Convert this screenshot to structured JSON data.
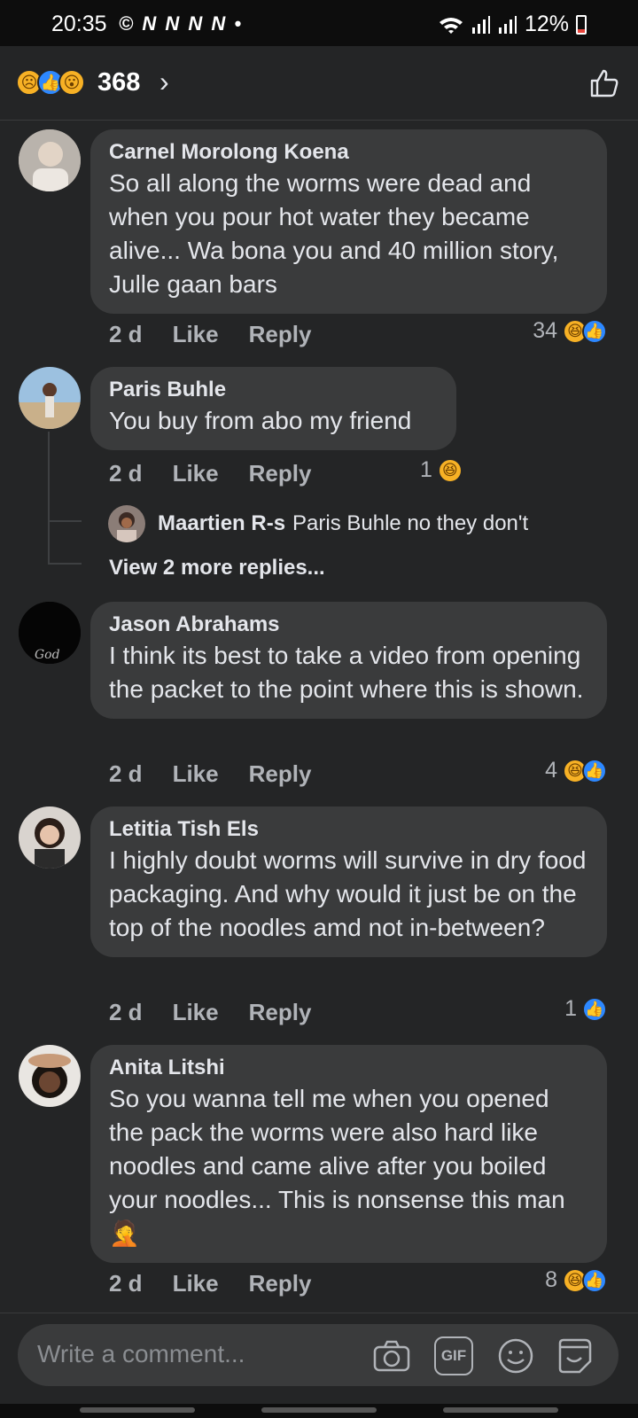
{
  "status": {
    "time": "20:35",
    "notifs": "© N N N N •",
    "battery": "12%"
  },
  "header": {
    "reaction_count": "368",
    "reaction_icons": [
      "sad-emoji-icon",
      "like-icon",
      "wow-emoji-icon"
    ]
  },
  "comments": [
    {
      "name": "Carnel Morolong Koena",
      "text": "So all along the worms were dead and when you pour hot water they became alive... Wa bona you and 40 million story, Julle gaan bars",
      "time": "2 d",
      "like": "Like",
      "reply": "Reply",
      "reaction_count": "34",
      "reactions": [
        "haha",
        "like"
      ]
    },
    {
      "name": "Paris Buhle",
      "text": "You buy from abo my friend",
      "time": "2 d",
      "like": "Like",
      "reply": "Reply",
      "reaction_count": "1",
      "reactions": [
        "haha"
      ],
      "reply_preview": {
        "name": "Maartien R-s",
        "text": "Paris Buhle no they don't"
      },
      "more_replies": "View 2 more replies..."
    },
    {
      "name": "Jason Abrahams",
      "text": "I think its best to take a video from opening the packet to the point where this is shown.",
      "time": "2 d",
      "like": "Like",
      "reply": "Reply",
      "reaction_count": "4",
      "reactions": [
        "haha",
        "like"
      ]
    },
    {
      "name": "Letitia Tish Els",
      "text": "I highly doubt worms will survive in dry food packaging. And why would it just be on the top of the noodles amd not in-between?",
      "time": "2 d",
      "like": "Like",
      "reply": "Reply",
      "reaction_count": "1",
      "reactions": [
        "like"
      ]
    },
    {
      "name": "Anita Litshi",
      "text": "So you wanna tell me when you opened the pack the worms were also hard like noodles and came alive after you boiled your noodles... This is nonsense this man 🤦",
      "time": "2 d",
      "like": "Like",
      "reply": "Reply",
      "reaction_count": "8",
      "reactions": [
        "haha",
        "like"
      ]
    }
  ],
  "composer": {
    "placeholder": "Write a comment...",
    "gif_label": "GIF"
  },
  "colors": {
    "background": "#242526",
    "bubble": "#3a3b3c",
    "like_blue": "#2d88ff",
    "haha_yellow": "#f7b125"
  }
}
